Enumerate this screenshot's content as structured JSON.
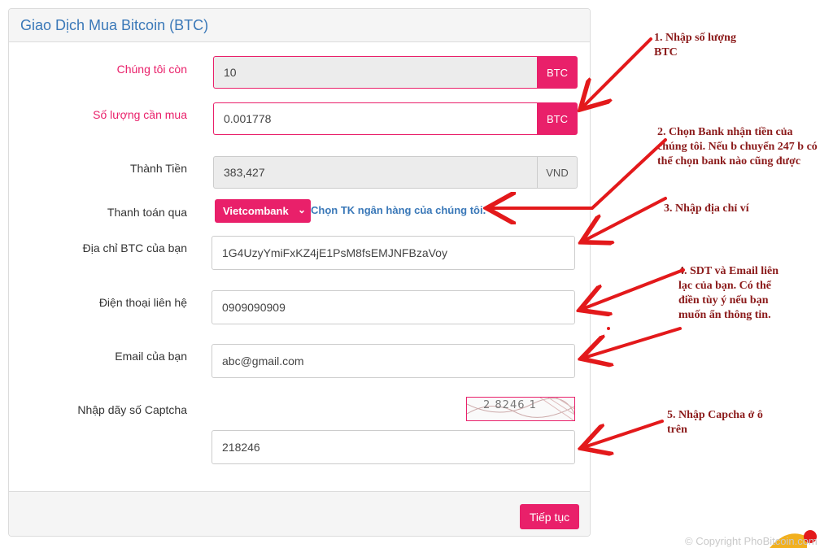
{
  "panel": {
    "title": "Giao Dịch Mua Bitcoin (BTC)"
  },
  "form": {
    "available": {
      "label": "Chúng tôi còn",
      "value": "10",
      "unit": "BTC"
    },
    "quantity": {
      "label": "Số lượng cần mua",
      "value": "0.001778",
      "unit": "BTC"
    },
    "total": {
      "label": "Thành Tiền",
      "value": "383,427",
      "unit": "VND"
    },
    "payment": {
      "label": "Thanh toán qua",
      "selected": "Vietcombank",
      "link": "Chọn TK ngân hàng của chúng tôi."
    },
    "btc_address": {
      "label": "Địa chỉ BTC của bạn",
      "value": "1G4UzyYmiFxKZ4jE1PsM8fsEMJNFBzaVoy"
    },
    "phone": {
      "label": "Điện thoại liên hệ",
      "value": "0909090909"
    },
    "email": {
      "label": "Email của bạn",
      "value": "abc@gmail.com"
    },
    "captcha": {
      "label": "Nhập dãy số Captcha",
      "image_text": "2 8246 1",
      "value": "218246"
    }
  },
  "footer": {
    "submit_label": "Tiếp tục"
  },
  "annotations": {
    "note1": "1. Nhập số lượng BTC",
    "note2": "2. Chọn Bank nhận tiền của chúng tôi. Nếu b chuyển 247 b có thể chọn bank nào cũng được",
    "note3": "3. Nhập địa chỉ ví",
    "note4": "4. SDT và Email liên lạc của bạn. Có thể điền tùy ý nếu bạn muốn ẩn thông tin.",
    "note5": "5. Nhập Capcha ở ô trên",
    "arrow_color": "#e3191b"
  },
  "copyright": "© Copyright PhoBitcoin.com",
  "colors": {
    "accent": "#e9206a",
    "title": "#3a78b8",
    "annotation": "#8b1a1a"
  }
}
